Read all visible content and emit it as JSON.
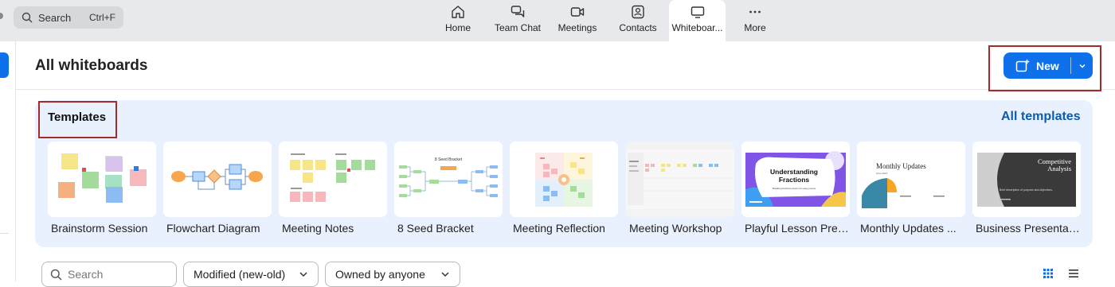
{
  "topbar": {
    "search_label": "Search",
    "search_shortcut": "Ctrl+F",
    "tabs": [
      {
        "label": "Home",
        "icon": "home-icon"
      },
      {
        "label": "Team Chat",
        "icon": "chat-icon"
      },
      {
        "label": "Meetings",
        "icon": "video-icon"
      },
      {
        "label": "Contacts",
        "icon": "contacts-icon"
      },
      {
        "label": "Whiteboar...",
        "icon": "whiteboard-icon",
        "active": true
      },
      {
        "label": "More",
        "icon": "more-icon"
      }
    ]
  },
  "header": {
    "title": "All whiteboards",
    "new_label": "New"
  },
  "templates": {
    "heading": "Templates",
    "all_link": "All templates",
    "items": [
      {
        "label": "Brainstorm Session"
      },
      {
        "label": "Flowchart Diagram"
      },
      {
        "label": "Meeting Notes"
      },
      {
        "label": "8 Seed Bracket"
      },
      {
        "label": "Meeting Reflection"
      },
      {
        "label": "Meeting Workshop"
      },
      {
        "label": "Playful Lesson Pres..."
      },
      {
        "label": "Monthly Updates ..."
      },
      {
        "label": "Business Presentat..."
      }
    ],
    "thumb_text": {
      "lesson_title": "Understanding Fractions",
      "lesson_sub": "Breaking fractions down into easy pieces",
      "monthly_title": "Monthly Updates",
      "monthly_date": "June 2023",
      "business_title": "Competitive Analysis",
      "business_sub": "Brief description of purpose and objectives.",
      "bracket_title": "8 Seed Bracket"
    }
  },
  "filters": {
    "search_placeholder": "Search",
    "sort_label": "Modified (new-old)",
    "owner_label": "Owned by anyone"
  },
  "colors": {
    "accent": "#0e71eb",
    "link": "#0b5cad",
    "highlight_box": "#a52a2a",
    "panel_bg": "#e8f1fd"
  }
}
